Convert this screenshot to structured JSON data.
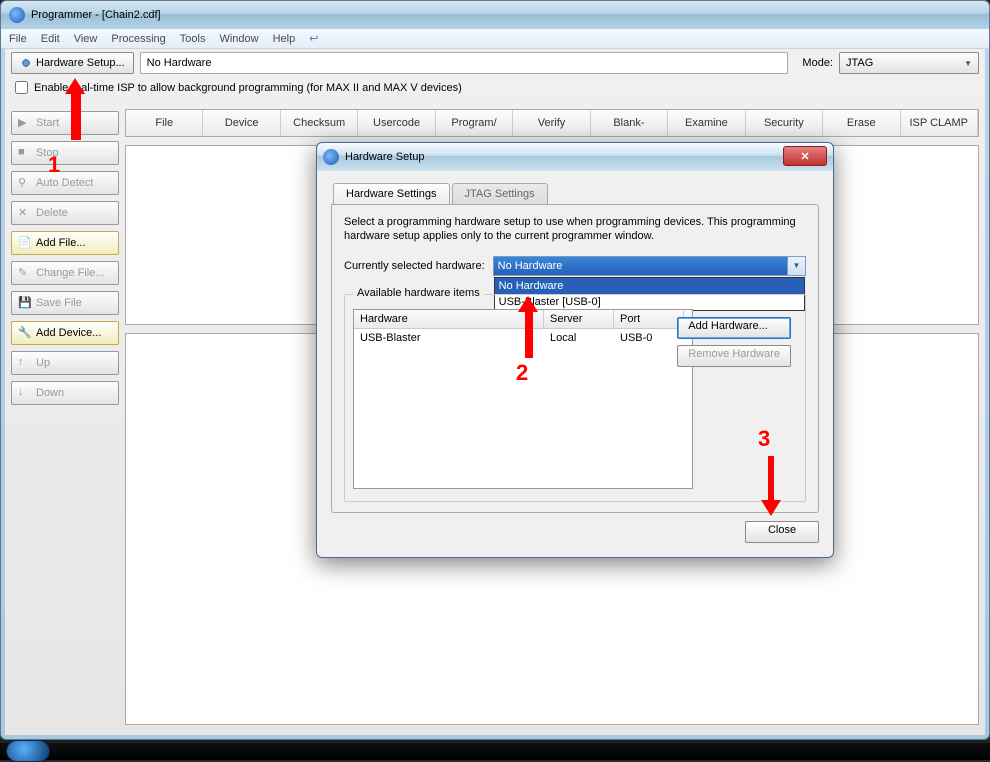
{
  "window": {
    "title": "Programmer - [Chain2.cdf]"
  },
  "menubar": [
    "File",
    "Edit",
    "View",
    "Processing",
    "Tools",
    "Window",
    "Help"
  ],
  "toolbar": {
    "hardware_setup": "Hardware Setup...",
    "no_hardware": "No Hardware",
    "mode_label": "Mode:",
    "mode_value": "JTAG"
  },
  "checkbox": {
    "label": "Enable real-time ISP to allow background programming (for MAX II and MAX V devices)"
  },
  "sidebar": {
    "items": [
      {
        "label": "Start",
        "disabled": true
      },
      {
        "label": "Stop",
        "disabled": true
      },
      {
        "label": "Auto Detect",
        "disabled": true
      },
      {
        "label": "Delete",
        "disabled": true
      },
      {
        "label": "Add File...",
        "active": true
      },
      {
        "label": "Change File...",
        "disabled": true
      },
      {
        "label": "Save File",
        "disabled": true
      },
      {
        "label": "Add Device...",
        "active": true
      },
      {
        "label": "Up",
        "disabled": true
      },
      {
        "label": "Down",
        "disabled": true
      }
    ]
  },
  "grid": {
    "columns": [
      "File",
      "Device",
      "Checksum",
      "Usercode",
      "Program/",
      "Verify",
      "Blank-",
      "Examine",
      "Security",
      "Erase",
      "ISP CLAMP"
    ]
  },
  "dialog": {
    "title": "Hardware Setup",
    "tabs": [
      "Hardware Settings",
      "JTAG Settings"
    ],
    "description": "Select a programming hardware setup to use when programming devices. This programming hardware setup applies only to the current programmer window.",
    "current_label": "Currently selected hardware:",
    "combo_value": "No Hardware",
    "combo_options": [
      "No Hardware",
      "USB-Blaster [USB-0]"
    ],
    "available_label": "Available hardware items",
    "table_headers": [
      "Hardware",
      "Server",
      "Port"
    ],
    "table_rows": [
      {
        "hardware": "USB-Blaster",
        "server": "Local",
        "port": "USB-0"
      }
    ],
    "add_button": "Add Hardware...",
    "remove_button": "Remove Hardware",
    "close_button": "Close"
  },
  "annotations": {
    "one": "1",
    "two": "2",
    "three": "3"
  }
}
